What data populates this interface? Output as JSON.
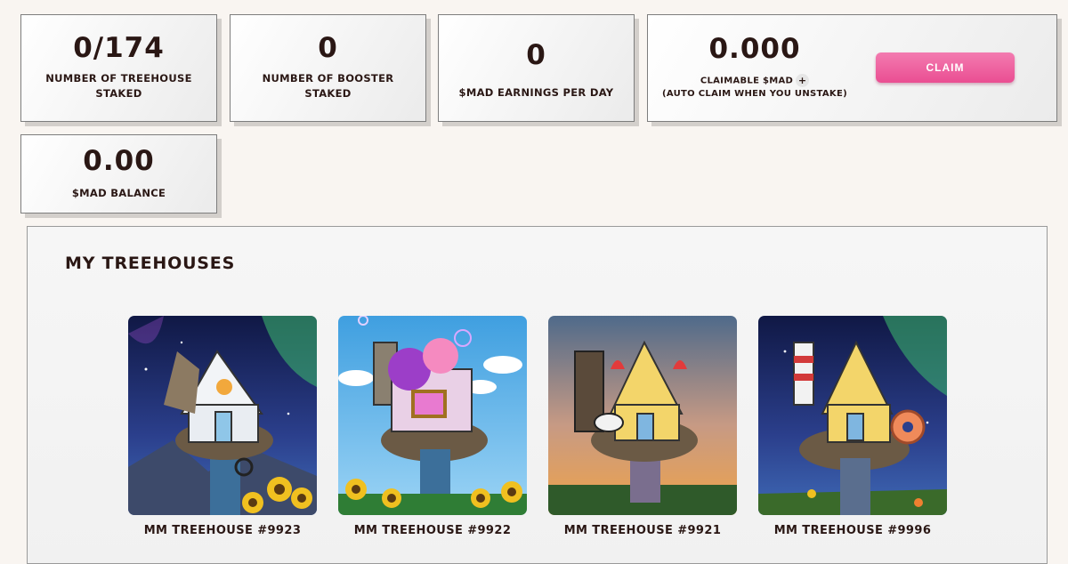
{
  "stats": {
    "treehouse_staked": {
      "value": "0/174",
      "label": "NUMBER OF TREEHOUSE STAKED"
    },
    "booster_staked": {
      "value": "0",
      "label": "NUMBER OF BOOSTER STAKED"
    },
    "earnings": {
      "value": "0",
      "label": "$MAD EARNINGS PER DAY"
    },
    "claimable": {
      "value": "0.000",
      "label_line1": "CLAIMABLE $MAD",
      "plus": "+",
      "label_line2": "(AUTO CLAIM WHEN YOU UNSTAKE)",
      "button": "CLAIM"
    },
    "balance": {
      "value": "0.00",
      "label": "$MAD BALANCE"
    }
  },
  "treehouses": {
    "title": "MY TREEHOUSES",
    "items": [
      {
        "name": "MM TREEHOUSE #9923",
        "scene": "aurora-night",
        "house_color": "white"
      },
      {
        "name": "MM TREEHOUSE #9922",
        "scene": "blue-sky",
        "house_color": "pink"
      },
      {
        "name": "MM TREEHOUSE #9921",
        "scene": "sunset",
        "house_color": "yellow"
      },
      {
        "name": "MM TREEHOUSE #9996",
        "scene": "aurora-night",
        "house_color": "yellow"
      }
    ]
  },
  "colors": {
    "accent": "#ea4e92",
    "text": "#2a1714",
    "background": "#f9f5f1"
  }
}
